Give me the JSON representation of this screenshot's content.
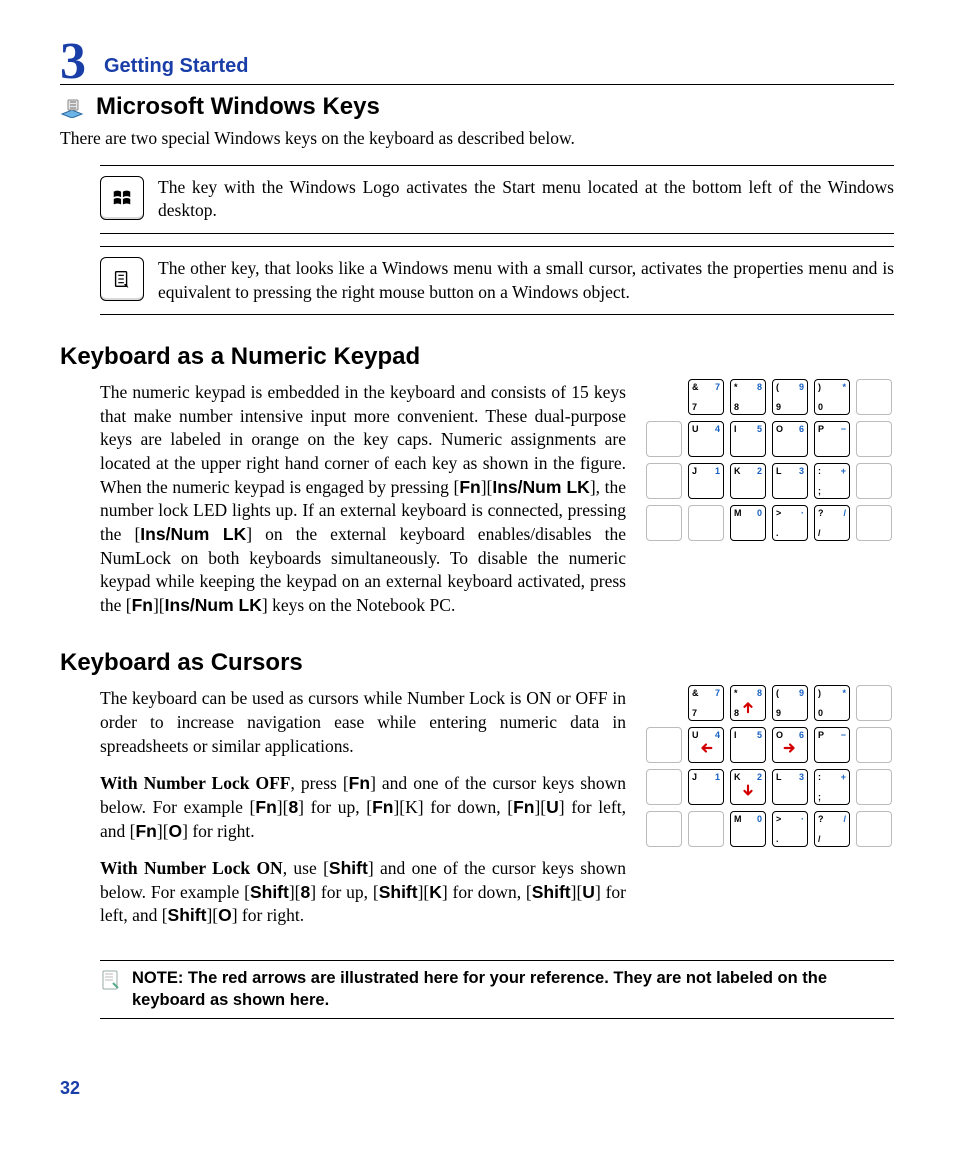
{
  "header": {
    "chapter_number": "3",
    "chapter_title": "Getting Started"
  },
  "page_number": "32",
  "section1": {
    "title": "Microsoft Windows Keys",
    "intro": "There are two special Windows keys on the keyboard as described below.",
    "key1_desc": "The key with the Windows Logo activates the Start menu located at the bottom left of the Windows desktop.",
    "key2_desc": "The other key, that looks like a Windows menu with a small cursor, activates the properties menu and is equivalent to pressing the right mouse button on a Windows object."
  },
  "section2": {
    "title": "Keyboard as a Numeric Keypad",
    "para_pre": "The numeric keypad is embedded in the keyboard and consists of 15 keys that make number intensive input more convenient. These dual-purpose keys are labeled in orange on the key caps. Numeric assignments are located at the upper right hand corner of each key as shown in the figure. When the numeric keypad is engaged by pressing [",
    "k1": "Fn",
    "mid1": "][",
    "k2": "Ins/Num LK",
    "para_mid1": "], the number lock LED lights up. If an external keyboard is connected, pressing the [",
    "k3": "Ins/Num LK",
    "para_mid2": "] on the external keyboard enables/disables the NumLock on both keyboards simultaneously. To disable the numeric keypad while keeping the keypad on an external keyboard activated, press the  [",
    "k4": "Fn",
    "mid2": "][",
    "k5": "Ins/Num LK",
    "para_end": "] keys on the Notebook PC."
  },
  "section3": {
    "title": "Keyboard as Cursors",
    "para1": "The keyboard can be used as cursors while Number Lock is ON or OFF in order to increase navigation ease while entering numeric data in spreadsheets or similar applications.",
    "p2_lead_b": "With Number Lock OFF",
    "p2_a": ", press [",
    "p2_fn": "Fn",
    "p2_b": "] and one of the cursor keys shown below. For example [",
    "p2_fn2": "Fn",
    "p2_c": "][",
    "p2_8": "8",
    "p2_d": "] for up, [",
    "p2_fn3": "Fn",
    "p2_e": "][K] for down, [",
    "p2_fn4": "Fn",
    "p2_f": "][",
    "p2_U": "U",
    "p2_g": "] for left, and [",
    "p2_fn5": "Fn",
    "p2_h": "][",
    "p2_O": "O",
    "p2_i": "] for right.",
    "p3_lead_b": "With Number Lock ON",
    "p3_a": ", use [",
    "p3_sh": "Shift",
    "p3_b": "] and one of the cursor keys shown below. For example [",
    "p3_sh2": "Shift",
    "p3_c": "][",
    "p3_8": "8",
    "p3_d": "] for up, [",
    "p3_sh3": "Shift",
    "p3_e": "][",
    "p3_K": "K",
    "p3_f": "] for down, [",
    "p3_sh4": "Shift",
    "p3_g": "][",
    "p3_U": "U",
    "p3_h": "] for left, and [",
    "p3_sh5": "Shift",
    "p3_i": "][",
    "p3_O": "O",
    "p3_j": "] for right."
  },
  "note": {
    "text": "NOTE: The red arrows are illustrated here for your reference. They are not labeled on the keyboard as shown here."
  },
  "kbd": {
    "r1": [
      {
        "tl": "&",
        "tr": "7",
        "bl": "7"
      },
      {
        "tl": "*",
        "tr": "8",
        "bl": "8"
      },
      {
        "tl": "(",
        "tr": "9",
        "bl": "9"
      },
      {
        "tl": ")",
        "tr": "*",
        "bl": "0"
      }
    ],
    "r2": [
      {
        "tl": "U",
        "tr": "4"
      },
      {
        "tl": "I",
        "tr": "5"
      },
      {
        "tl": "O",
        "tr": "6"
      },
      {
        "tl": "P",
        "tr": "−"
      }
    ],
    "r3": [
      {
        "tl": "J",
        "tr": "1"
      },
      {
        "tl": "K",
        "tr": "2"
      },
      {
        "tl": "L",
        "tr": "3"
      },
      {
        "tl": ":",
        "tr": "+",
        "bl": ";"
      }
    ],
    "r4": [
      {
        "tl": "M",
        "tr": "0"
      },
      {
        "tl": ">",
        "tr": "·",
        "bl": "."
      },
      {
        "tl": "?",
        "tr": "/",
        "bl": "/"
      }
    ]
  }
}
